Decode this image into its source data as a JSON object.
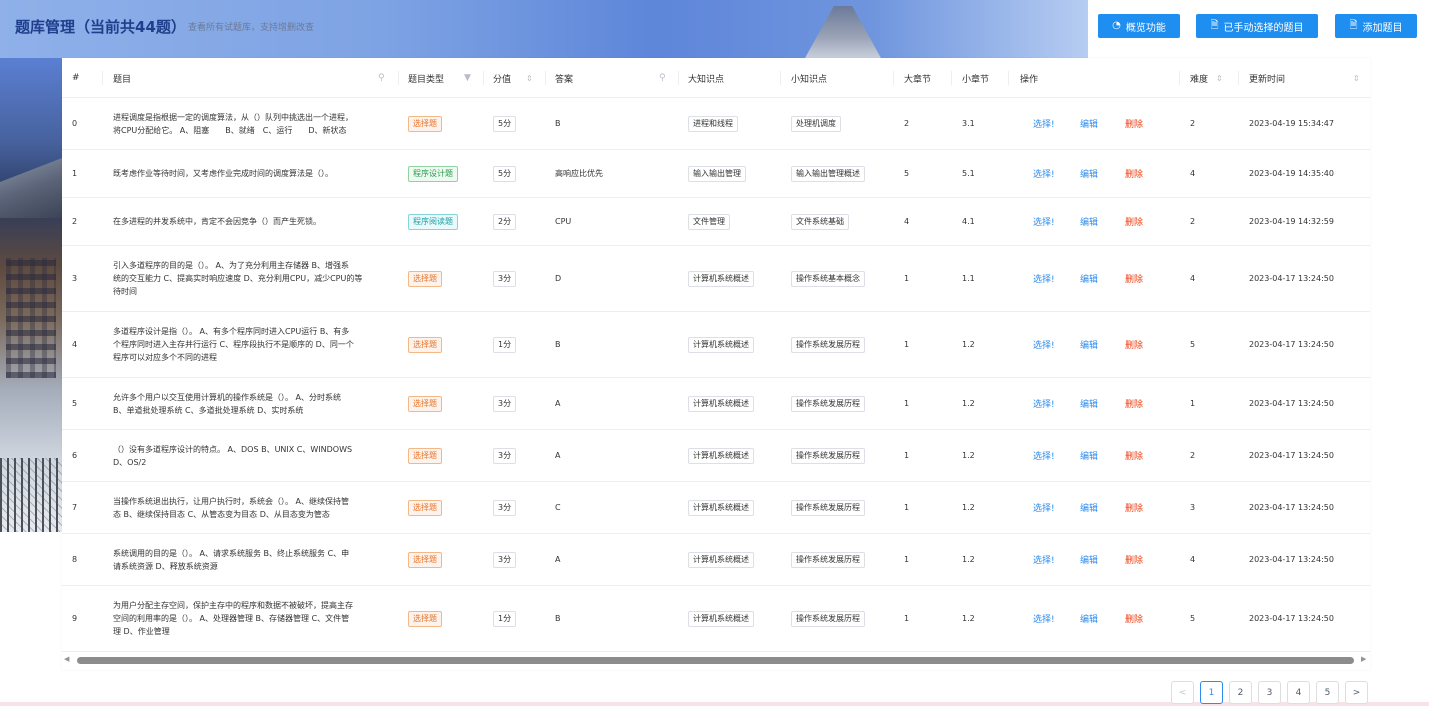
{
  "header": {
    "title": "题库管理（当前共44题）",
    "subtitle": "查看所有试题库，支持增删改查",
    "buttons": {
      "overview": "概览功能",
      "selected": "已手动选择的题目",
      "add": "添加题目"
    }
  },
  "colors": {
    "primary": "#1f8ef1",
    "link": "#2d8cf0",
    "danger": "#ed4014",
    "title": "#1f3e8c"
  },
  "icons": {
    "overview": "gauge-icon",
    "selected": "document-icon",
    "add": "document-icon",
    "search": "search-icon",
    "filter": "filter-icon",
    "sort": "sort-icon"
  },
  "table": {
    "columns": {
      "idx": "#",
      "question": "题目",
      "type": "题目类型",
      "score": "分值",
      "answer": "答案",
      "big": "大知识点",
      "small": "小知识点",
      "chapter": "大章节",
      "section": "小章节",
      "ops": "操作",
      "difficulty": "难度",
      "time": "更新时间"
    },
    "ops": {
      "select": "选择!",
      "edit": "编辑",
      "delete": "删除"
    },
    "rows": [
      {
        "idx": "0",
        "q": [
          "进程调度是指根据一定的调度算法，从（）队列中挑选出一个进程，",
          "将CPU分配给它。 A、阻塞　　B、就绪　C、运行　　D、新状态"
        ],
        "type": "选择题",
        "typeKind": "choice",
        "score": "5分",
        "answer": "B",
        "big": "进程和线程",
        "small": "处理机调度",
        "chapter": "2",
        "section": "3.1",
        "difficulty": "2",
        "time": "2023-04-19 15:34:47"
      },
      {
        "idx": "1",
        "q": [
          "既考虑作业等待时间，又考虑作业完成时间的调度算法是（）。"
        ],
        "type": "程序设计题",
        "typeKind": "design",
        "score": "5分",
        "answer": "高响应比优先",
        "big": "输入输出管理",
        "small": "输入输出管理概述",
        "chapter": "5",
        "section": "5.1",
        "difficulty": "4",
        "time": "2023-04-19 14:35:40"
      },
      {
        "idx": "2",
        "q": [
          "在多进程的并发系统中，肯定不会因竞争（）而产生死锁。"
        ],
        "type": "程序阅读题",
        "typeKind": "read",
        "score": "2分",
        "answer": "CPU",
        "big": "文件管理",
        "small": "文件系统基础",
        "chapter": "4",
        "section": "4.1",
        "difficulty": "2",
        "time": "2023-04-19 14:32:59"
      },
      {
        "idx": "3",
        "q": [
          "引入多道程序的目的是（）。 A、为了充分利用主存储器 B、增强系",
          "统的交互能力 C、提高实时响应速度 D、充分利用CPU，减少CPU的等",
          "待时间"
        ],
        "type": "选择题",
        "typeKind": "choice",
        "score": "3分",
        "answer": "D",
        "big": "计算机系统概述",
        "small": "操作系统基本概念",
        "chapter": "1",
        "section": "1.1",
        "difficulty": "4",
        "time": "2023-04-17 13:24:50"
      },
      {
        "idx": "4",
        "q": [
          "多道程序设计是指（）。 A、有多个程序同时进入CPU运行 B、有多",
          "个程序同时进入主存并行运行 C、程序段执行不是顺序的 D、同一个",
          "程序可以对应多个不同的进程"
        ],
        "type": "选择题",
        "typeKind": "choice",
        "score": "1分",
        "answer": "B",
        "big": "计算机系统概述",
        "small": "操作系统发展历程",
        "chapter": "1",
        "section": "1.2",
        "difficulty": "5",
        "time": "2023-04-17 13:24:50"
      },
      {
        "idx": "5",
        "q": [
          "允许多个用户以交互使用计算机的操作系统是（）。 A、分时系统",
          "B、单道批处理系统 C、多道批处理系统 D、实时系统"
        ],
        "type": "选择题",
        "typeKind": "choice",
        "score": "3分",
        "answer": "A",
        "big": "计算机系统概述",
        "small": "操作系统发展历程",
        "chapter": "1",
        "section": "1.2",
        "difficulty": "1",
        "time": "2023-04-17 13:24:50"
      },
      {
        "idx": "6",
        "q": [
          "（）没有多道程序设计的特点。 A、DOS B、UNIX C、WINDOWS",
          "D、OS/2"
        ],
        "type": "选择题",
        "typeKind": "choice",
        "score": "3分",
        "answer": "A",
        "big": "计算机系统概述",
        "small": "操作系统发展历程",
        "chapter": "1",
        "section": "1.2",
        "difficulty": "2",
        "time": "2023-04-17 13:24:50"
      },
      {
        "idx": "7",
        "q": [
          "当操作系统退出执行，让用户执行时，系统会（）。 A、继续保持管",
          "态 B、继续保持目态 C、从管态变为目态 D、从目态变为管态"
        ],
        "type": "选择题",
        "typeKind": "choice",
        "score": "3分",
        "answer": "C",
        "big": "计算机系统概述",
        "small": "操作系统发展历程",
        "chapter": "1",
        "section": "1.2",
        "difficulty": "3",
        "time": "2023-04-17 13:24:50"
      },
      {
        "idx": "8",
        "q": [
          "系统调用的目的是（）。 A、请求系统服务 B、终止系统服务 C、申",
          "请系统资源 D、释放系统资源"
        ],
        "type": "选择题",
        "typeKind": "choice",
        "score": "3分",
        "answer": "A",
        "big": "计算机系统概述",
        "small": "操作系统发展历程",
        "chapter": "1",
        "section": "1.2",
        "difficulty": "4",
        "time": "2023-04-17 13:24:50"
      },
      {
        "idx": "9",
        "q": [
          "为用户分配主存空间，保护主存中的程序和数据不被破坏，提高主存",
          "空间的利用率的是（）。 A、处理器管理 B、存储器管理 C、文件管",
          "理 D、作业管理"
        ],
        "type": "选择题",
        "typeKind": "choice",
        "score": "1分",
        "answer": "B",
        "big": "计算机系统概述",
        "small": "操作系统发展历程",
        "chapter": "1",
        "section": "1.2",
        "difficulty": "5",
        "time": "2023-04-17 13:24:50"
      }
    ]
  },
  "pagination": {
    "prev": "<",
    "next": ">",
    "pages": [
      "1",
      "2",
      "3",
      "4",
      "5"
    ],
    "current": "1"
  }
}
